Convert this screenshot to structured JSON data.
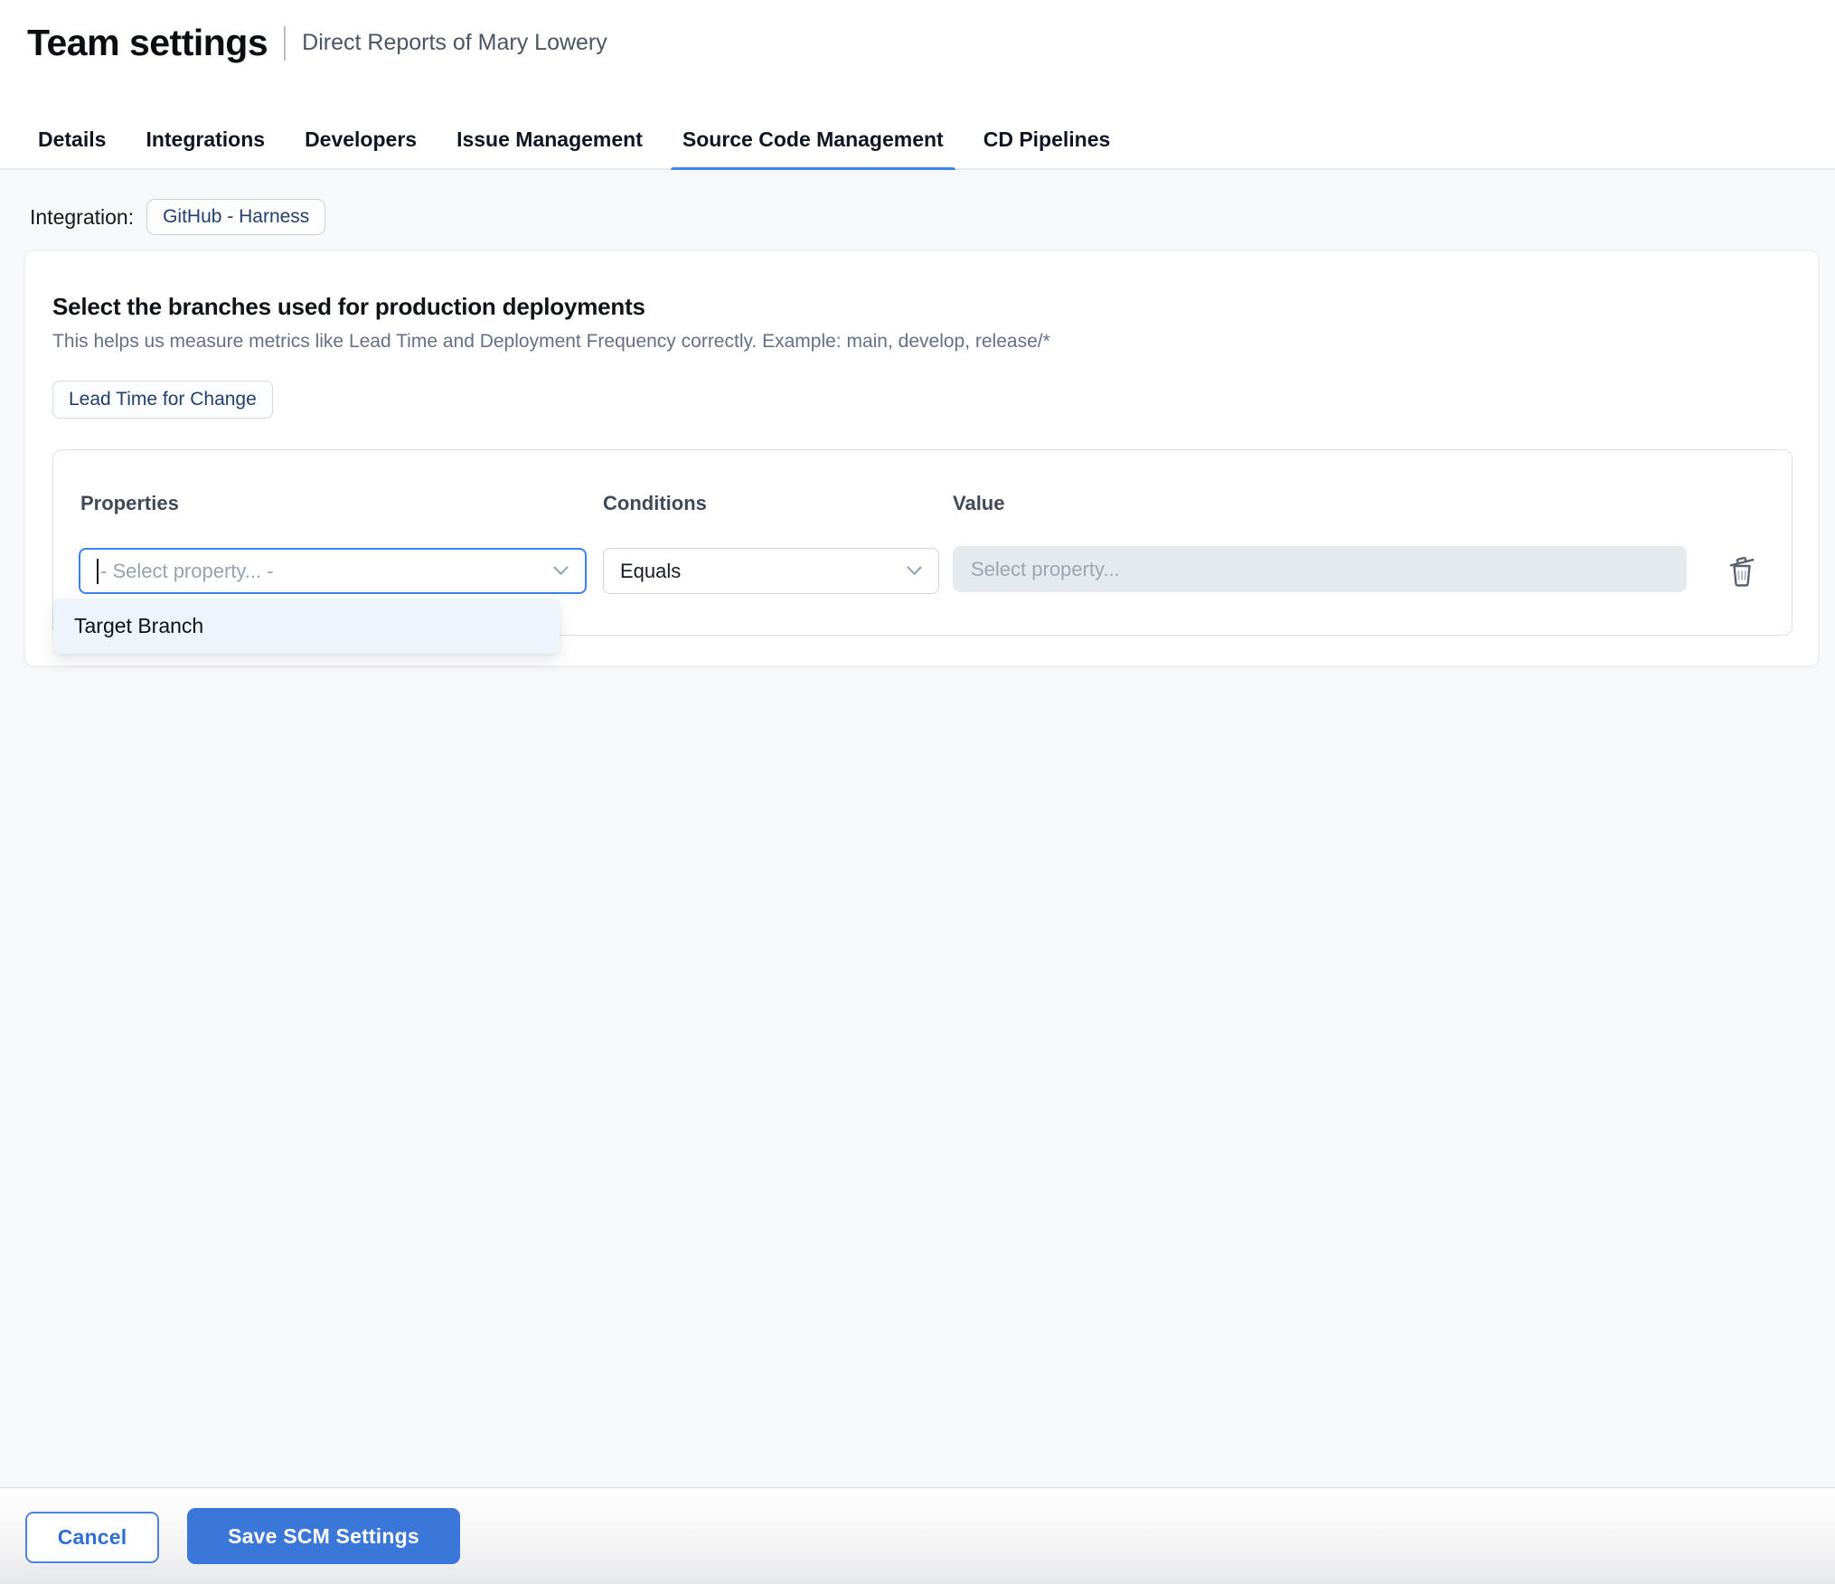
{
  "header": {
    "title": "Team settings",
    "subtitle": "Direct Reports of Mary Lowery"
  },
  "tabs": {
    "items": [
      {
        "label": "Details",
        "active": false
      },
      {
        "label": "Integrations",
        "active": false
      },
      {
        "label": "Developers",
        "active": false
      },
      {
        "label": "Issue Management",
        "active": false
      },
      {
        "label": "Source Code Management",
        "active": true
      },
      {
        "label": "CD Pipelines",
        "active": false
      }
    ]
  },
  "integration": {
    "label": "Integration:",
    "chip": "GitHub - Harness"
  },
  "card": {
    "heading": "Select the branches used for production deployments",
    "description": "This helps us measure metrics like Lead Time and Deployment Frequency correctly. Example: main, develop, release/*",
    "metric_chip": "Lead Time for Change"
  },
  "rule": {
    "properties_label": "Properties",
    "conditions_label": "Conditions",
    "value_label": "Value",
    "property_placeholder": "- Select property... -",
    "condition_value": "Equals",
    "value_placeholder": "Select property...",
    "dropdown_options": [
      "Target Branch"
    ]
  },
  "icons": {
    "property_chevron": "chevron-down-icon",
    "condition_chevron": "chevron-down-icon",
    "delete": "trash-icon"
  },
  "footer": {
    "cancel_label": "Cancel",
    "save_label": "Save SCM Settings"
  },
  "colors": {
    "accent_blue": "#3b82f6",
    "navy_text": "#22406d",
    "save_blue": "#3b77d8"
  }
}
